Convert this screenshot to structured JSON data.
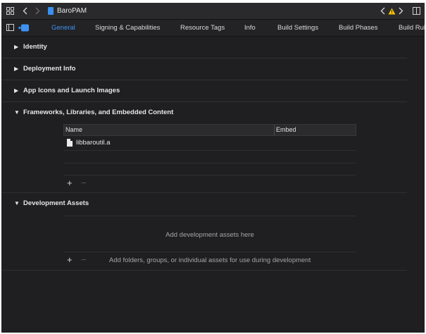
{
  "toolbar": {
    "grid_icon": "grid-icon",
    "back_icon": "chevron-left-icon",
    "forward_icon": "chevron-right-icon",
    "file_name": "BaroPAM",
    "warning_icon": "warning-icon",
    "inspector_icon": "split-panel-icon"
  },
  "tabs": [
    {
      "label": "General",
      "active": true
    },
    {
      "label": "Signing & Capabilities",
      "active": false
    },
    {
      "label": "Resource Tags",
      "active": false
    },
    {
      "label": "Info",
      "active": false
    },
    {
      "label": "Build Settings",
      "active": false
    },
    {
      "label": "Build Phases",
      "active": false
    },
    {
      "label": "Build Rule",
      "active": false
    }
  ],
  "sections": {
    "identity": "Identity",
    "deployment": "Deployment Info",
    "app_icons": "App Icons and Launch Images",
    "frameworks": "Frameworks, Libraries, and Embedded Content",
    "dev_assets": "Development Assets"
  },
  "frameworks_table": {
    "col_name": "Name",
    "col_embed": "Embed",
    "rows": [
      {
        "name": "libbaroutil.a"
      }
    ]
  },
  "dev_assets": {
    "placeholder": "Add development assets here",
    "hint": "Add folders, groups, or individual assets for use during development"
  },
  "controls": {
    "plus": "+",
    "minus": "−"
  },
  "colors": {
    "accent": "#3f92f2",
    "warning": "#f5c400",
    "background": "#1f1f21"
  }
}
